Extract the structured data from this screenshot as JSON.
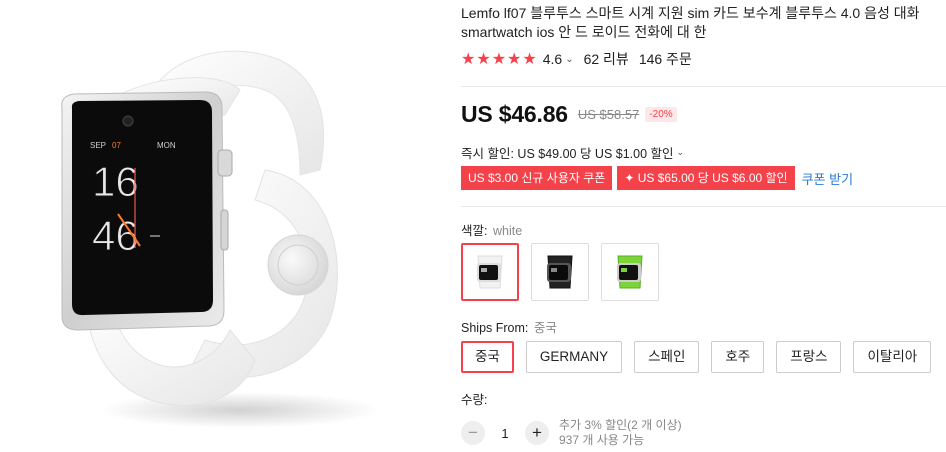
{
  "product": {
    "title_line1": "Lemfo lf07 블루투스 스마트 시계 지원 sim 카드 보수계 블루투스 4.0 음성 대화",
    "title_line2": "smartwatch ios 안 드 로이드 전화에 대 한"
  },
  "watch_face": {
    "month": "SEP",
    "day": "07",
    "weekday": "MON",
    "hour": "16",
    "minute": "46"
  },
  "rating": {
    "stars": 5,
    "value": "4.6",
    "caret": "⌄",
    "reviews": "62 리뷰",
    "orders": "146 주문"
  },
  "price": {
    "current": "US $46.86",
    "original": "US $58.57",
    "discount": "-20%"
  },
  "instant_discount": {
    "text": "즉시 할인: US $49.00 당 US $1.00 할인",
    "caret": "⌄"
  },
  "coupons": {
    "items": [
      "US $3.00 신규 사용자 쿠폰",
      "✦ US $65.00 당 US $6.00 할인"
    ],
    "link": "쿠폰 받기"
  },
  "color": {
    "label": "색깔:",
    "selected": "white",
    "options": [
      "white",
      "black",
      "green"
    ],
    "swatch_colors": [
      "#f2f2f2",
      "#222222",
      "#7cd43a"
    ]
  },
  "ships_from": {
    "label": "Ships From:",
    "selected": "중국",
    "options": [
      "중국",
      "GERMANY",
      "스페인",
      "호주",
      "프랑스",
      "이탈리아"
    ]
  },
  "quantity": {
    "label": "수량:",
    "value": "1",
    "minus": "−",
    "plus": "+",
    "note_line1": "추가 3% 할인(2 개 이상)",
    "note_line2": "937 개 사용 가능"
  },
  "colors": {
    "accent": "#f5414d",
    "link": "#2a7ad6"
  }
}
